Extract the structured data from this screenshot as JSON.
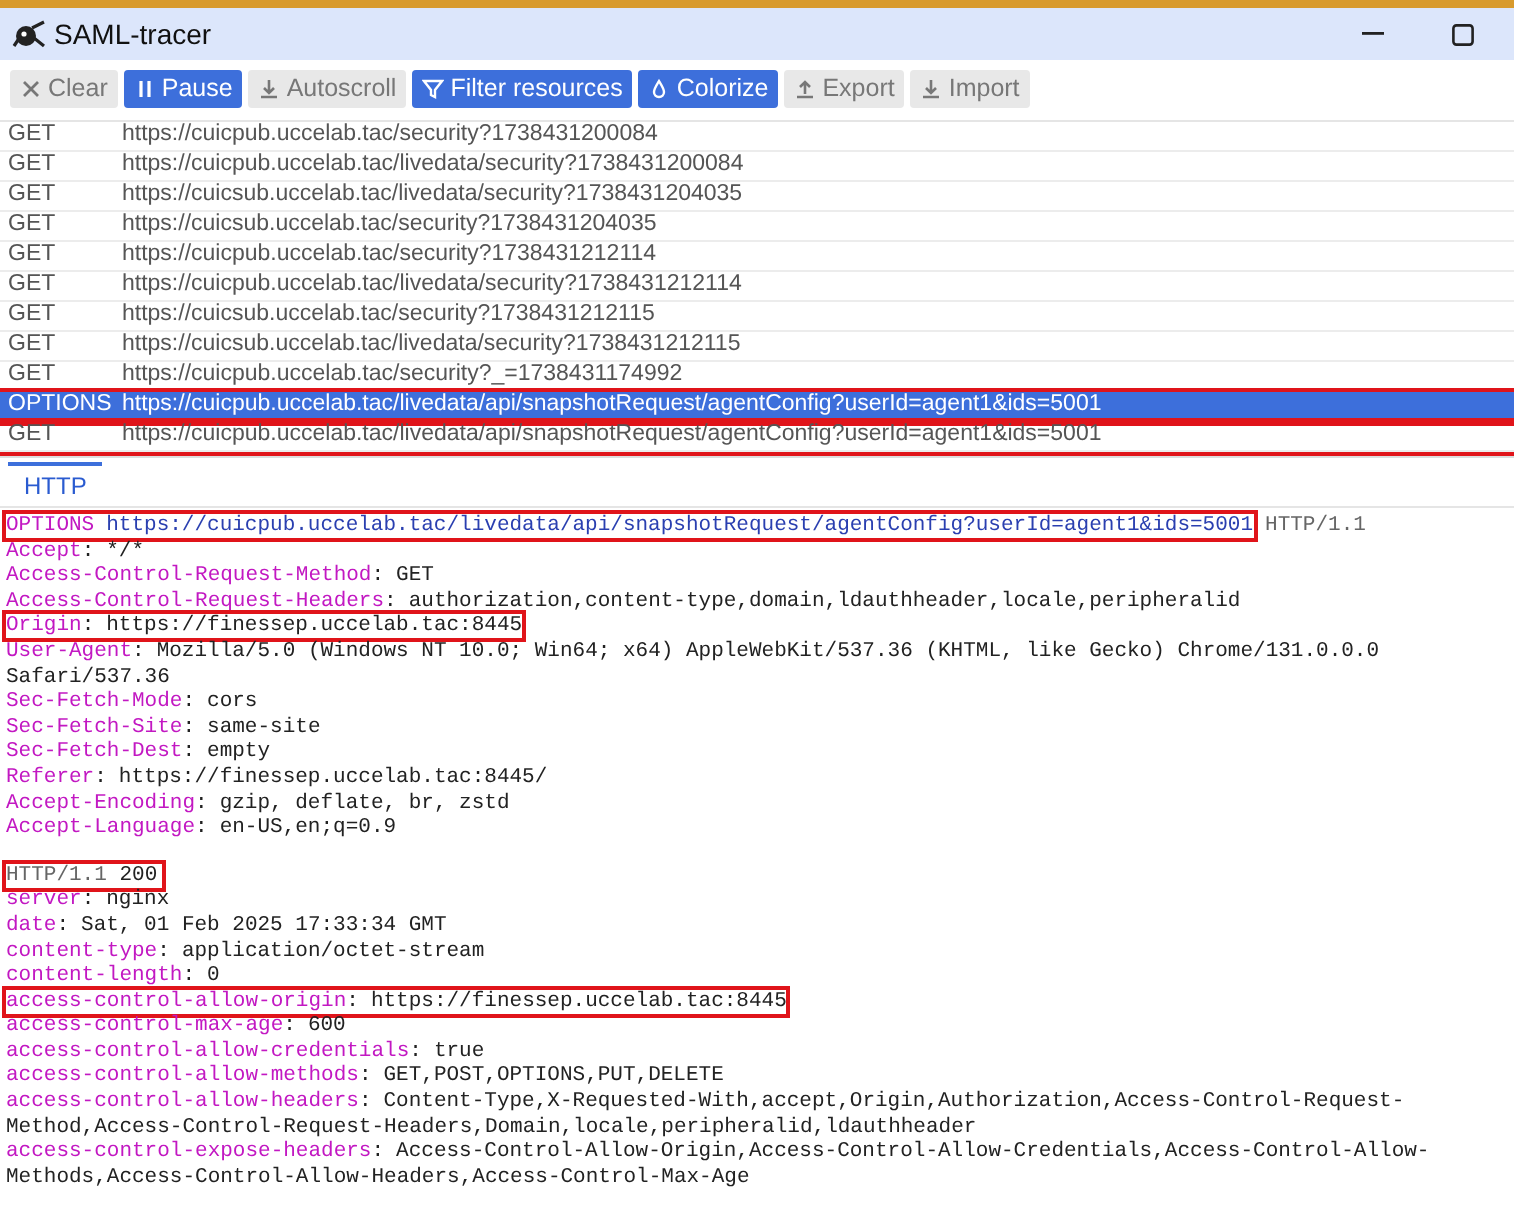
{
  "window": {
    "title": "SAML-tracer"
  },
  "toolbar": [
    {
      "label": "Clear",
      "kind": "x",
      "active": false
    },
    {
      "label": "Pause",
      "kind": "pause",
      "active": true
    },
    {
      "label": "Autoscroll",
      "kind": "download",
      "active": false
    },
    {
      "label": "Filter resources",
      "kind": "filter",
      "active": true
    },
    {
      "label": "Colorize",
      "kind": "drop",
      "active": true
    },
    {
      "label": "Export",
      "kind": "upload",
      "active": false
    },
    {
      "label": "Import",
      "kind": "download",
      "active": false
    }
  ],
  "requests": [
    {
      "method": "GET",
      "url": "https://cuicpub.uccelab.tac/security?1738431200084",
      "selected": false,
      "highlighted": false
    },
    {
      "method": "GET",
      "url": "https://cuicpub.uccelab.tac/livedata/security?1738431200084",
      "selected": false,
      "highlighted": false
    },
    {
      "method": "GET",
      "url": "https://cuicsub.uccelab.tac/livedata/security?1738431204035",
      "selected": false,
      "highlighted": false
    },
    {
      "method": "GET",
      "url": "https://cuicsub.uccelab.tac/security?1738431204035",
      "selected": false,
      "highlighted": false
    },
    {
      "method": "GET",
      "url": "https://cuicpub.uccelab.tac/security?1738431212114",
      "selected": false,
      "highlighted": false
    },
    {
      "method": "GET",
      "url": "https://cuicpub.uccelab.tac/livedata/security?1738431212114",
      "selected": false,
      "highlighted": false
    },
    {
      "method": "GET",
      "url": "https://cuicsub.uccelab.tac/security?1738431212115",
      "selected": false,
      "highlighted": false
    },
    {
      "method": "GET",
      "url": "https://cuicsub.uccelab.tac/livedata/security?1738431212115",
      "selected": false,
      "highlighted": false
    },
    {
      "method": "GET",
      "url": "https://cuicpub.uccelab.tac/security?_=1738431174992",
      "selected": false,
      "highlighted": false
    },
    {
      "method": "OPTIONS",
      "url": "https://cuicpub.uccelab.tac/livedata/api/snapshotRequest/agentConfig?userId=agent1&ids=5001",
      "selected": true,
      "highlighted": true
    },
    {
      "method": "GET",
      "url": "https://cuicpub.uccelab.tac/livedata/api/snapshotRequest/agentConfig?userId=agent1&ids=5001",
      "selected": false,
      "highlighted": true
    }
  ],
  "tabs": [
    {
      "label": "HTTP",
      "selected": true
    }
  ],
  "request_line": {
    "method": "OPTIONS",
    "url": "https://cuicpub.uccelab.tac/livedata/api/snapshotRequest/agentConfig?userId=agent1&ids=5001",
    "version": "HTTP/1.1",
    "highlighted": true
  },
  "header_separator": ":",
  "request_headers": [
    {
      "name": "Accept",
      "value": "*/*",
      "highlighted": false
    },
    {
      "name": "Access-Control-Request-Method",
      "value": "GET",
      "highlighted": false
    },
    {
      "name": "Access-Control-Request-Headers",
      "value": "authorization,content-type,domain,ldauthheader,locale,peripheralid",
      "highlighted": false
    },
    {
      "name": "Origin",
      "value": "https://finessep.uccelab.tac:8445",
      "highlighted": true
    },
    {
      "name": "User-Agent",
      "value": "Mozilla/5.0 (Windows NT 10.0; Win64; x64) AppleWebKit/537.36 (KHTML, like Gecko) Chrome/131.0.0.0 Safari/537.36",
      "highlighted": false
    },
    {
      "name": "Sec-Fetch-Mode",
      "value": "cors",
      "highlighted": false
    },
    {
      "name": "Sec-Fetch-Site",
      "value": "same-site",
      "highlighted": false
    },
    {
      "name": "Sec-Fetch-Dest",
      "value": "empty",
      "highlighted": false
    },
    {
      "name": "Referer",
      "value": "https://finessep.uccelab.tac:8445/",
      "highlighted": false
    },
    {
      "name": "Accept-Encoding",
      "value": "gzip, deflate, br, zstd",
      "highlighted": false
    },
    {
      "name": "Accept-Language",
      "value": "en-US,en;q=0.9",
      "highlighted": false
    }
  ],
  "status_line": {
    "version": "HTTP/1.1",
    "code": "200",
    "highlighted": true
  },
  "response_headers": [
    {
      "name": "server",
      "value": "nginx",
      "highlighted": false
    },
    {
      "name": "date",
      "value": "Sat, 01 Feb 2025 17:33:34 GMT",
      "highlighted": false
    },
    {
      "name": "content-type",
      "value": "application/octet-stream",
      "highlighted": false
    },
    {
      "name": "content-length",
      "value": "0",
      "highlighted": false
    },
    {
      "name": "access-control-allow-origin",
      "value": "https://finessep.uccelab.tac:8445",
      "highlighted": true
    },
    {
      "name": "access-control-max-age",
      "value": "600",
      "highlighted": false
    },
    {
      "name": "access-control-allow-credentials",
      "value": "true",
      "highlighted": false
    },
    {
      "name": "access-control-allow-methods",
      "value": "GET,POST,OPTIONS,PUT,DELETE",
      "highlighted": false
    },
    {
      "name": "access-control-allow-headers",
      "value": "Content-Type,X-Requested-With,accept,Origin,Authorization,Access-Control-Request-Method,Access-Control-Request-Headers,Domain,locale,peripheralid,ldauthheader",
      "highlighted": false
    },
    {
      "name": "access-control-expose-headers",
      "value": "Access-Control-Allow-Origin,Access-Control-Allow-Credentials,Access-Control-Allow-Methods,Access-Control-Allow-Headers,Access-Control-Max-Age",
      "highlighted": false
    }
  ]
}
